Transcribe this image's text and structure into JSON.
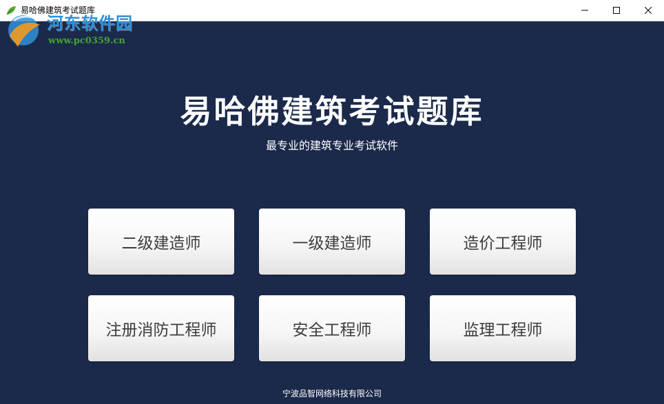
{
  "window": {
    "title": "易哈佛建筑考试题库",
    "controls": {
      "minimize_icon": "minimize-icon",
      "maximize_icon": "maximize-icon",
      "close_icon": "close-icon"
    }
  },
  "watermark": {
    "name": "河东软件园",
    "url": "www.pc0359.cn"
  },
  "header": {
    "title": "易哈佛建筑考试题库",
    "subtitle": "最专业的建筑专业考试软件"
  },
  "exams": [
    {
      "label": "二级建造师"
    },
    {
      "label": "一级建造师"
    },
    {
      "label": "造价工程师"
    },
    {
      "label": "注册消防工程师"
    },
    {
      "label": "安全工程师"
    },
    {
      "label": "监理工程师"
    }
  ],
  "footer": {
    "company": "宁波品智网络科技有限公司"
  },
  "colors": {
    "background": "#1b2a4b",
    "title_text": "#ffffff",
    "button_text": "#3c3c3c",
    "watermark_blue": "#2f8fd8",
    "watermark_green": "#43a72f"
  }
}
